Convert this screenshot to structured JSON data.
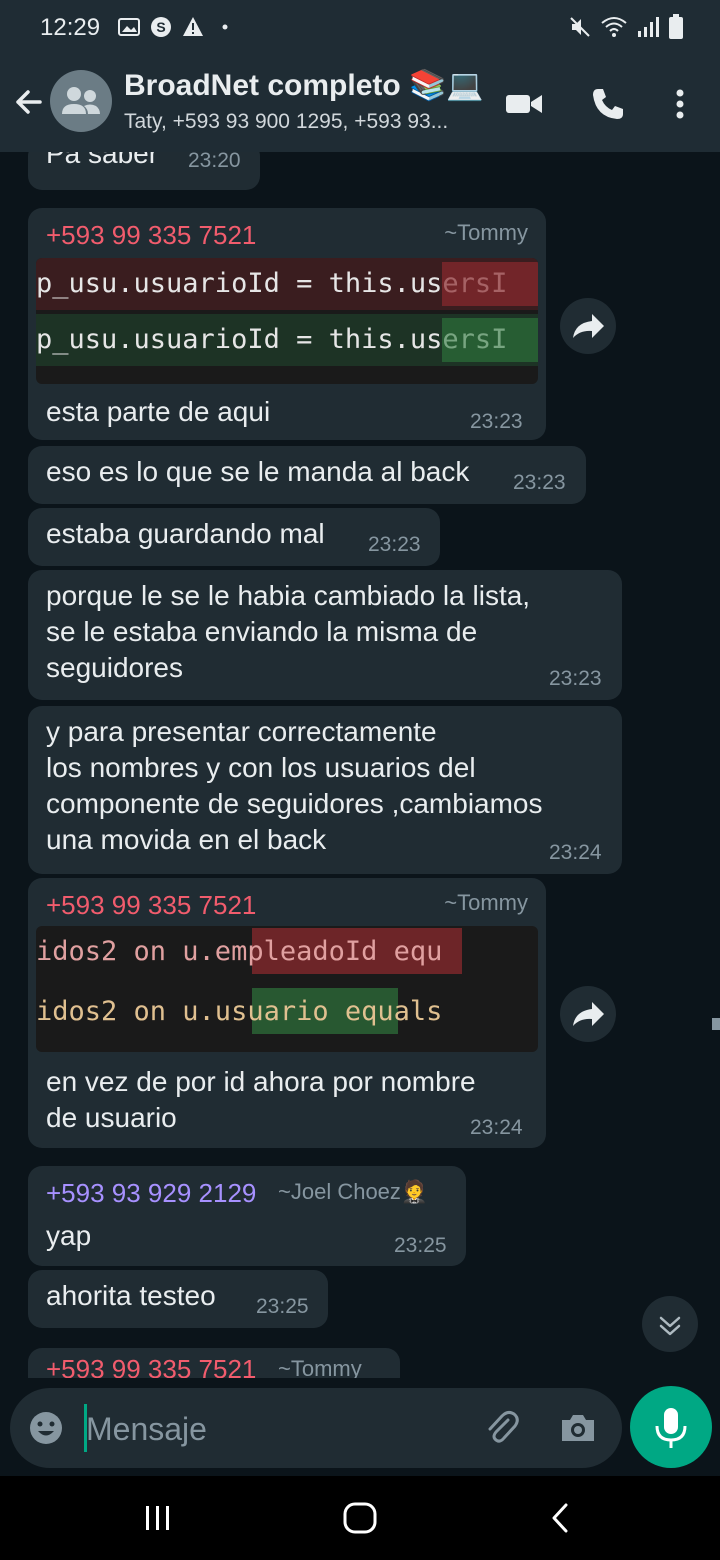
{
  "status_bar": {
    "time": "12:29"
  },
  "header": {
    "title": "BroadNet completo 📚💻",
    "subtitle": "Taty, +593 93 900 1295, +593 93..."
  },
  "messages": {
    "m0": {
      "text": "Pa saber",
      "time": "23:20"
    },
    "m1": {
      "sender": "+593 99 335 7521",
      "alias": "~Tommy",
      "code": [
        "p_usu.usuarioId = this.usersI",
        "p_usu.usuarioId = this.usersI"
      ],
      "text": "esta parte de aqui",
      "time": "23:23"
    },
    "m2": {
      "text": "eso es lo que se le manda al back",
      "time": "23:23"
    },
    "m3": {
      "text": "estaba guardando mal",
      "time": "23:23"
    },
    "m4": {
      "text": "porque le se le habia cambiado la lista,\nse le estaba enviando la misma de\nseguidores",
      "time": "23:23"
    },
    "m5": {
      "text": "y para presentar correctamente\nlos nombres y con los usuarios del\ncomponente de seguidores ,cambiamos\nuna movida en el back",
      "time": "23:24"
    },
    "m6": {
      "sender": "+593 99 335 7521",
      "alias": "~Tommy",
      "code": [
        "idos2 on u.empleadoId equ",
        "idos2 on u.usuario equals"
      ],
      "text": "en vez de por id ahora por nombre\nde usuario",
      "time": "23:24"
    },
    "m7": {
      "sender": "+593 93 929 2129",
      "alias": "~Joel Choez🤵",
      "text": "yap",
      "time": "23:25"
    },
    "m8": {
      "text": "ahorita testeo",
      "time": "23:25"
    },
    "m9": {
      "sender": "+593 99 335 7521",
      "alias": "~Tommy"
    }
  },
  "composer": {
    "placeholder": "Mensaje"
  },
  "colors": {
    "sender_red": "#f15c6d",
    "sender_purple": "#a791ff",
    "accent": "#00a884",
    "bubble": "#202c33",
    "background": "#0b141a"
  },
  "icons": [
    "back-arrow-icon",
    "group-avatar-icon",
    "video-call-icon",
    "voice-call-icon",
    "more-options-icon",
    "forward-icon",
    "scroll-down-icon",
    "emoji-icon",
    "attach-icon",
    "camera-icon",
    "mic-icon",
    "recents-nav-icon",
    "home-nav-icon",
    "back-nav-icon"
  ]
}
